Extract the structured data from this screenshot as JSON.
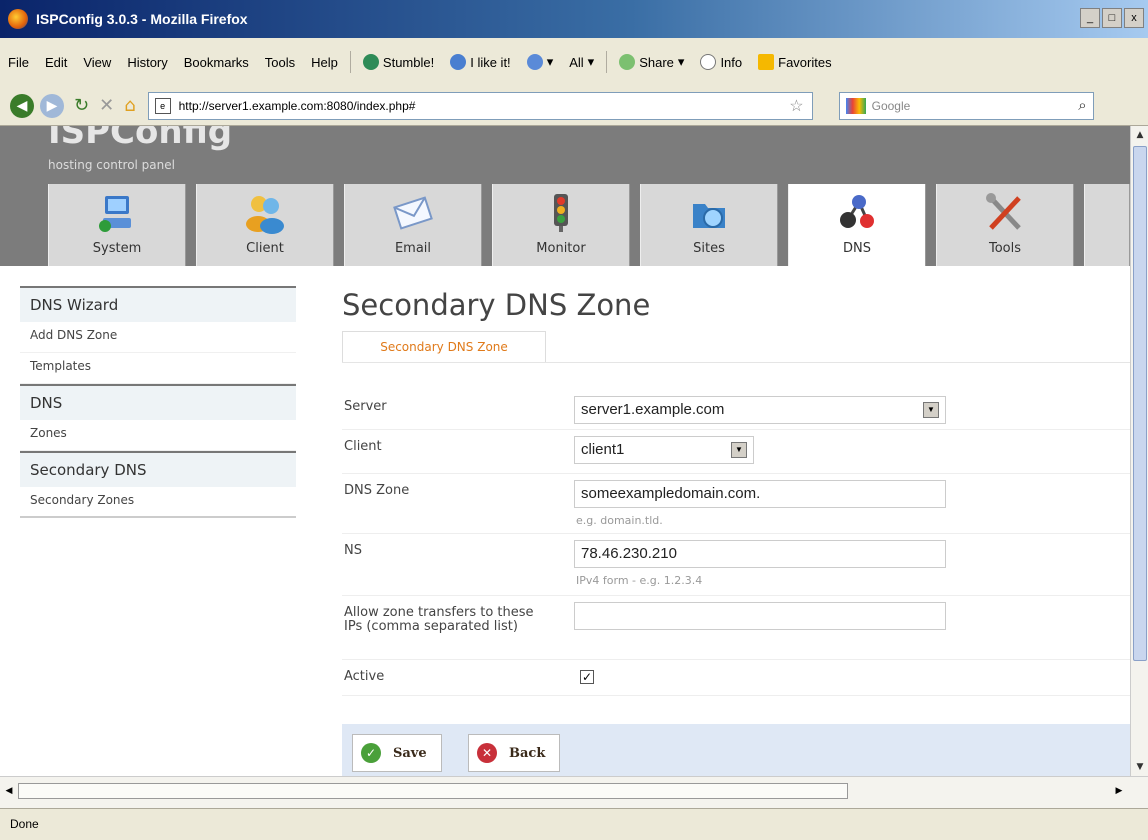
{
  "window": {
    "title": "ISPConfig 3.0.3 - Mozilla Firefox",
    "controls": [
      "_",
      "□",
      "x"
    ]
  },
  "menu": [
    "File",
    "Edit",
    "View",
    "History",
    "Bookmarks",
    "Tools",
    "Help"
  ],
  "toolbar": {
    "stumble": "Stumble!",
    "ilike": "I like it!",
    "all": "All",
    "share": "Share",
    "info": "Info",
    "favorites": "Favorites"
  },
  "nav": {
    "url": "http://server1.example.com:8080/index.php#",
    "search_placeholder": "Google"
  },
  "banner": {
    "logo": "ISPConfig",
    "tagline": "hosting control panel"
  },
  "tabs": [
    {
      "label": "System",
      "icon": "system-icon"
    },
    {
      "label": "Client",
      "icon": "client-icon"
    },
    {
      "label": "Email",
      "icon": "email-icon"
    },
    {
      "label": "Monitor",
      "icon": "monitor-icon"
    },
    {
      "label": "Sites",
      "icon": "sites-icon"
    },
    {
      "label": "DNS",
      "icon": "dns-icon",
      "active": true
    },
    {
      "label": "Tools",
      "icon": "tools-icon"
    }
  ],
  "sidebar": {
    "groups": [
      {
        "title": "DNS Wizard",
        "items": [
          "Add DNS Zone",
          "Templates"
        ]
      },
      {
        "title": "DNS",
        "items": [
          "Zones"
        ]
      },
      {
        "title": "Secondary DNS",
        "items": [
          "Secondary Zones"
        ]
      }
    ]
  },
  "main": {
    "title": "Secondary DNS Zone",
    "form_tab": "Secondary DNS Zone",
    "fields": {
      "server": {
        "label": "Server",
        "value": "server1.example.com"
      },
      "client": {
        "label": "Client",
        "value": "client1"
      },
      "zone": {
        "label": "DNS Zone",
        "value": "someexampledomain.com.",
        "hint": "e.g. domain.tld."
      },
      "ns": {
        "label": "NS",
        "value": "78.46.230.210",
        "hint": "IPv4 form - e.g. 1.2.3.4"
      },
      "xfer": {
        "label": "Allow zone transfers to these IPs (comma separated list)",
        "value": ""
      },
      "active": {
        "label": "Active",
        "checked": true,
        "mark": "✓"
      }
    },
    "buttons": {
      "save": "Save",
      "back": "Back"
    }
  },
  "status": "Done",
  "colors": {
    "accent_orange": "#e07a1a",
    "banner_gray": "#7c7c7c",
    "button_bar": "#dfe8f5",
    "sidebar_head": "#eef3f6"
  }
}
